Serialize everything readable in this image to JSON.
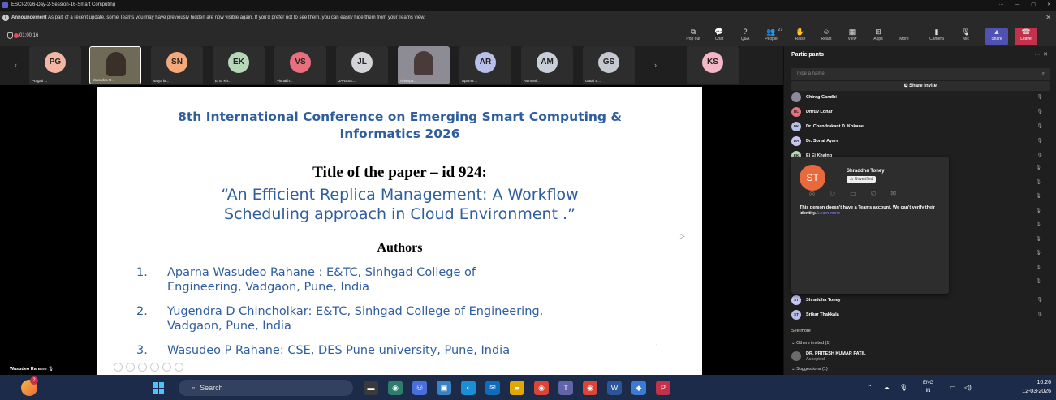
{
  "window": {
    "title": "ESCI-2026-Day-2-Session-16-Smart Computing",
    "controls": [
      "···",
      "—",
      "▢",
      "✕"
    ]
  },
  "announcement": {
    "label": "Announcement",
    "text": "As part of a recent update, some Teams you may have previously hidden are now visible again. If you'd prefer not to see them, you can easily hide them from your Teams view."
  },
  "toolbar": {
    "timer": "01:00:16",
    "buttons": [
      {
        "label": "Pop out",
        "icon": "popout-icon",
        "glyph": "⧉"
      },
      {
        "label": "Chat",
        "icon": "chat-icon",
        "glyph": "💬"
      },
      {
        "label": "Q&A",
        "icon": "qa-icon",
        "glyph": "?"
      },
      {
        "label": "People",
        "icon": "people-icon",
        "glyph": "👥",
        "count": "27"
      },
      {
        "label": "Raise",
        "icon": "raise-hand-icon",
        "glyph": "✋"
      },
      {
        "label": "React",
        "icon": "react-icon",
        "glyph": "☺"
      },
      {
        "label": "View",
        "icon": "view-icon",
        "glyph": "▦"
      },
      {
        "label": "Apps",
        "icon": "apps-icon",
        "glyph": "⊞"
      },
      {
        "label": "More",
        "icon": "more-icon",
        "glyph": "···"
      },
      {
        "label": "Camera",
        "icon": "camera-icon",
        "glyph": "▮"
      },
      {
        "label": "Mic",
        "icon": "mic-icon",
        "glyph": "🎙"
      },
      {
        "label": "Share",
        "icon": "share-icon",
        "glyph": "▲"
      },
      {
        "label": "Leave",
        "icon": "leave-icon",
        "glyph": "☎"
      }
    ]
  },
  "gallery": {
    "tiles": [
      {
        "initials": "PG",
        "name": "Pragati ...",
        "color": "#f4b6a4"
      },
      {
        "initials": "",
        "name": "Wasudeo R...",
        "video": true
      },
      {
        "initials": "SN",
        "name": "satya kr...",
        "color": "#f3a97a"
      },
      {
        "initials": "EK",
        "name": "Ei Ei Kh...",
        "color": "#b7d8b8"
      },
      {
        "initials": "VS",
        "name": "Vishakh...",
        "color": "#e76f7e"
      },
      {
        "initials": "JL",
        "name": "JANSSE...",
        "color": "#d3d3d8"
      },
      {
        "initials": "",
        "name": "Anisopa...",
        "video2": true
      },
      {
        "initials": "AR",
        "name": "Aparna ...",
        "color": "#b8bfe8"
      },
      {
        "initials": "AM",
        "name": "Asim Mi...",
        "color": "#c8cfd8"
      },
      {
        "initials": "GS",
        "name": "Gauri S...",
        "color": "#c5c8d0"
      },
      {
        "initials": "KS",
        "name": "",
        "color": "#f4b7c5"
      }
    ]
  },
  "slide": {
    "conference_line1": "8th International Conference on Emerging Smart Computing &",
    "conference_line2": "Informatics 2026",
    "title_line": "Title of the paper – id 924:",
    "paper_line1": "“An Efficient Replica Management: A Workflow",
    "paper_line2": "Scheduling approach in Cloud Environment .”",
    "authors_heading": "Authors",
    "authors": [
      {
        "num": "1.",
        "line1": "Aparna Wasudeo Rahane : E&TC,  Sinhgad College of",
        "line2": "Engineering, Vadgaon, Pune, India"
      },
      {
        "num": "2.",
        "line1": "Yugendra D Chincholkar: E&TC,  Sinhgad College of Engineering,",
        "line2": "Vadgaon, Pune, India"
      },
      {
        "num": "3.",
        "line1": "Wasudeo P Rahane: CSE, DES Pune university, Pune, India",
        "line2": ""
      }
    ],
    "page_num": "1"
  },
  "presenter": "Wasudeo Rahane",
  "participants": {
    "heading": "Participants",
    "search_placeholder": "Type a name",
    "share_invite": "Share invite",
    "list_top": [
      {
        "initials": "",
        "name": "Chirag Gandhi",
        "color": "#8a8a9a"
      },
      {
        "initials": "DL",
        "name": "Dhruv Lohar",
        "color": "#e76f7e"
      },
      {
        "initials": "DK",
        "name": "Dr. Chandrakant D. Kokane",
        "color": "#b8bfe8"
      },
      {
        "initials": "DA",
        "name": "Dr. Sonal Ayare",
        "color": "#c7c7f0"
      },
      {
        "initials": "EK",
        "name": "Ei Ei Khaing",
        "color": "#b7d8b8"
      }
    ],
    "list_bottom": [
      {
        "initials": "ST",
        "name": "Shraddha Toney",
        "color": "#c7c7f0"
      },
      {
        "initials": "ST",
        "name": "Srikar Thakkala",
        "color": "#b8bfe8"
      }
    ],
    "see_more": "See more",
    "others_invited": "Others invited (1)",
    "invited_name": "DR. PRITESH KUMAR PATIL",
    "invited_status": "Accepted",
    "suggestions": "Suggestions (1)",
    "card": {
      "initials": "ST",
      "name": "Shraddha Toney",
      "badge": "Unverified",
      "message": "This person doesn't have a Teams account. We can't verify their identity.",
      "learn_more": "Learn more"
    }
  },
  "taskbar": {
    "notif_count": "2",
    "search_label": "Search",
    "lang_top": "ENG",
    "lang_bottom": "IN",
    "time": "10:26",
    "date": "12-03-2026"
  }
}
